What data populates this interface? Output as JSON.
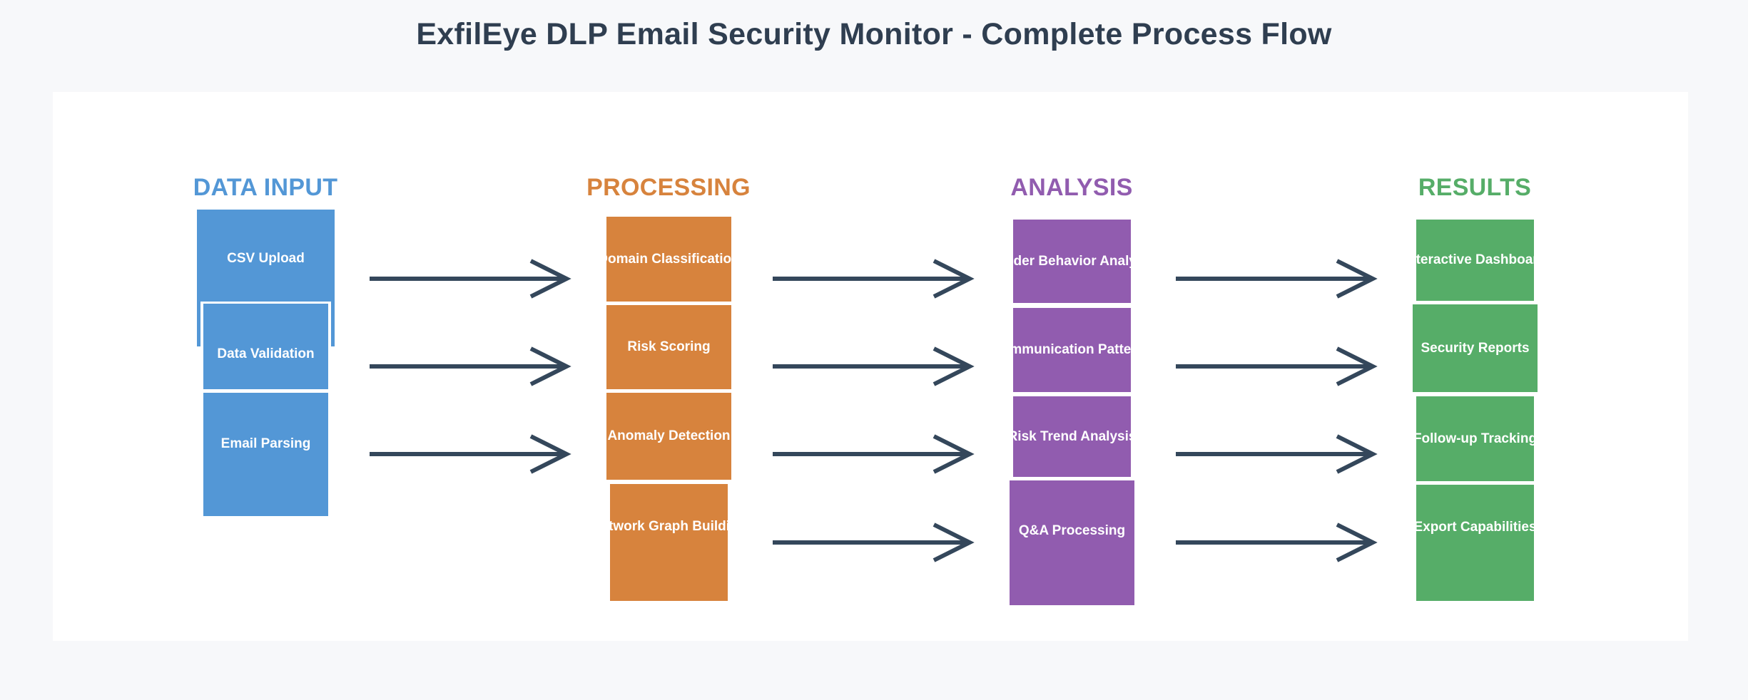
{
  "title": "ExfilEye DLP Email Security Monitor - Complete Process Flow",
  "colors": {
    "input": "#5397d6",
    "processing": "#d7833d",
    "analysis": "#915caf",
    "results": "#56ad68",
    "arrow": "#34475b",
    "title": "#2f3e50"
  },
  "columns": {
    "input": {
      "header": "DATA INPUT",
      "boxes": [
        "CSV Upload",
        "Data Validation",
        "Email Parsing"
      ]
    },
    "processing": {
      "header": "PROCESSING",
      "boxes": [
        "Domain Classification",
        "Risk Scoring",
        "Anomaly Detection",
        "Network Graph Building"
      ]
    },
    "analysis": {
      "header": "ANALYSIS",
      "boxes": [
        "Sender Behavior Analysis",
        "Communication Patterns",
        "Risk Trend Analysis",
        "Q&A Processing"
      ]
    },
    "results": {
      "header": "RESULTS",
      "boxes": [
        "Interactive Dashboard",
        "Security Reports",
        "Follow-up Tracking",
        "Export Capabilities"
      ]
    }
  }
}
